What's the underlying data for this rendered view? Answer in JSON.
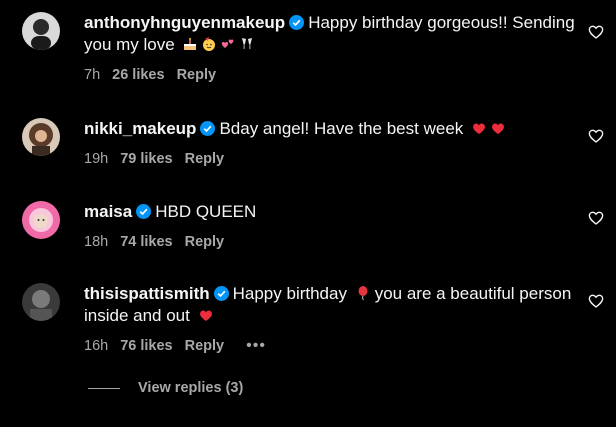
{
  "comments": [
    {
      "username": "anthonyhnguyenmakeup",
      "text": "Happy birthday gorgeous!! Sending you my love",
      "time": "7h",
      "likes": "26 likes",
      "reply": "Reply"
    },
    {
      "username": "nikki_makeup",
      "text": "Bday angel! Have the best week",
      "time": "19h",
      "likes": "79 likes",
      "reply": "Reply"
    },
    {
      "username": "maisa",
      "text": "HBD QUEEN",
      "time": "18h",
      "likes": "74 likes",
      "reply": "Reply"
    },
    {
      "username": "thisispattismith",
      "text_part1": "Happy birthday",
      "text_part2": "you are a beautiful person inside and out",
      "time": "16h",
      "likes": "76 likes",
      "reply": "Reply",
      "more": "•••"
    }
  ],
  "view_replies": "View replies (3)",
  "colors": {
    "background": "#000000",
    "text": "#f5f5f5",
    "secondary": "#a8a8a8",
    "verified": "#0095f6",
    "heart_red": "#ed2d3c"
  }
}
